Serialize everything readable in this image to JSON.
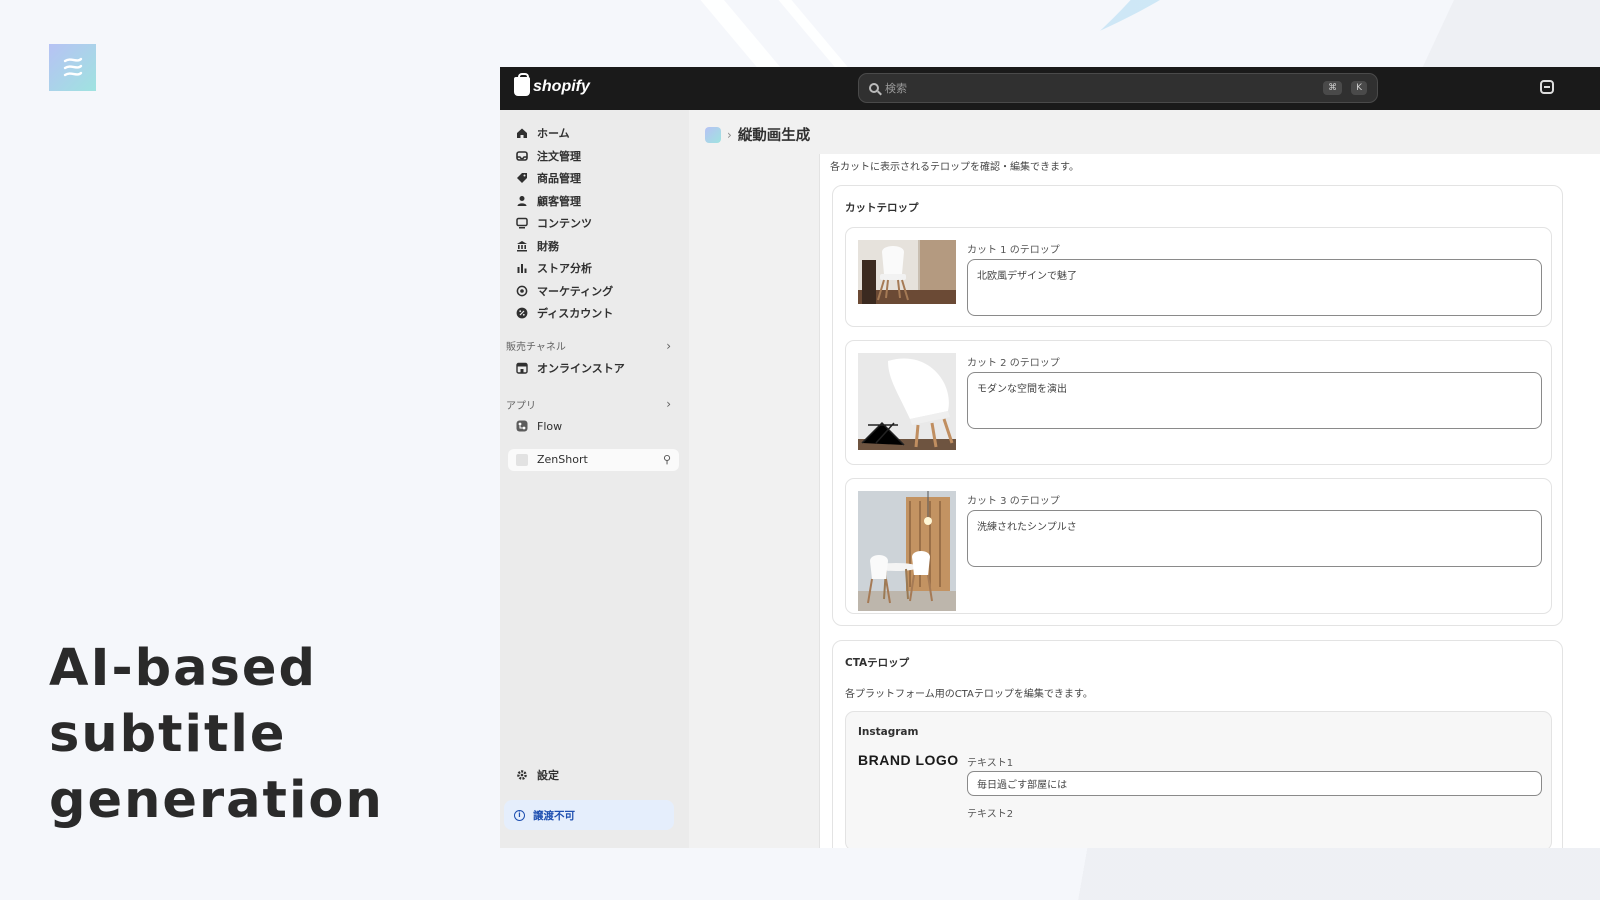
{
  "slide": {
    "headline": [
      "AI-based",
      "subtitle",
      "generation"
    ]
  },
  "topbar": {
    "brand": "shopify",
    "search_placeholder": "検索",
    "shortcut_keys": [
      "⌘",
      "K"
    ]
  },
  "sidebar": {
    "items": [
      {
        "label": "ホーム",
        "icon": "home-icon"
      },
      {
        "label": "注文管理",
        "icon": "inbox-icon"
      },
      {
        "label": "商品管理",
        "icon": "tag-icon"
      },
      {
        "label": "顧客管理",
        "icon": "person-icon"
      },
      {
        "label": "コンテンツ",
        "icon": "content-icon"
      },
      {
        "label": "財務",
        "icon": "bank-icon"
      },
      {
        "label": "ストア分析",
        "icon": "bar-chart-icon"
      },
      {
        "label": "マーケティング",
        "icon": "target-icon"
      },
      {
        "label": "ディスカウント",
        "icon": "discount-icon"
      }
    ],
    "sales_channels": {
      "title": "販売チャネル",
      "items": [
        "オンラインストア"
      ]
    },
    "apps": {
      "title": "アプリ",
      "items": [
        "Flow"
      ]
    },
    "pinned_app": "ZenShort",
    "settings_label": "設定",
    "notice": "譲渡不可"
  },
  "main": {
    "breadcrumb_title": "縦動画生成",
    "intro_text": "各カットに表示されるテロップを確認・編集できます。",
    "cut_section": {
      "title": "カットテロップ",
      "cuts": [
        {
          "label": "カット 1 のテロップ",
          "value": "北欧風デザインで魅了"
        },
        {
          "label": "カット 2 のテロップ",
          "value": "モダンな空間を演出"
        },
        {
          "label": "カット 3 のテロップ",
          "value": "洗練されたシンプルさ"
        }
      ]
    },
    "cta_section": {
      "title": "CTAテロップ",
      "description": "各プラットフォーム用のCTAテロップを編集できます。",
      "platform": {
        "name": "Instagram",
        "brand_logo": "BRAND LOGO",
        "text1_label": "テキスト1",
        "text1_value": "毎日過ごす部屋には",
        "text2_label": "テキスト2"
      }
    }
  }
}
